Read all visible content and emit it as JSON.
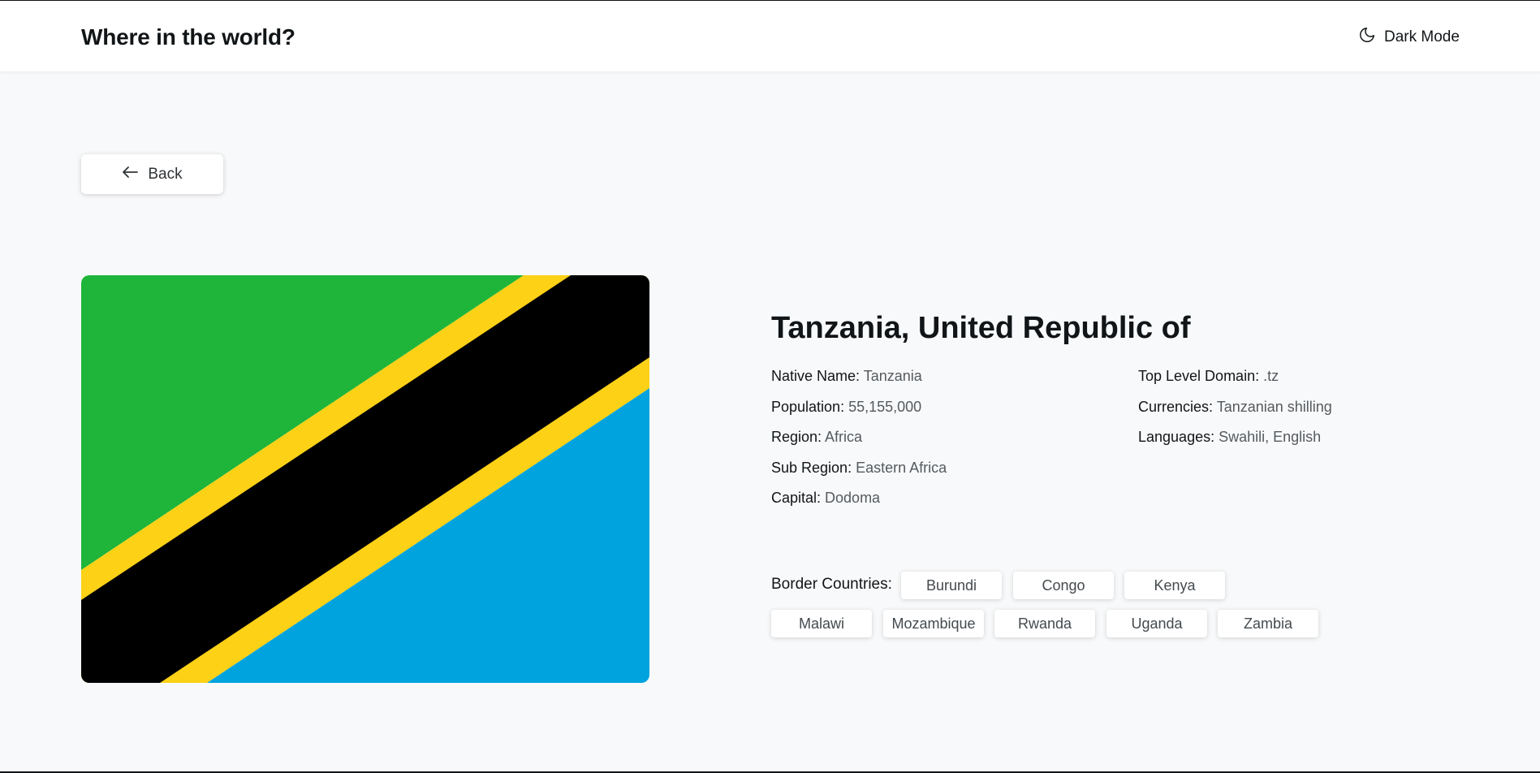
{
  "header": {
    "title": "Where in the world?",
    "theme_toggle_label": "Dark Mode",
    "theme_icon": "moon-icon"
  },
  "back_button": {
    "label": "Back",
    "icon": "arrow-left-icon"
  },
  "country": {
    "name": "Tanzania, United Republic of",
    "flag_colors": {
      "green": "#1eb53a",
      "yellow": "#fcd116",
      "black": "#000000",
      "blue": "#00a3dd"
    },
    "details_left": [
      {
        "label": "Native Name:",
        "value": "Tanzania"
      },
      {
        "label": "Population:",
        "value": "55,155,000"
      },
      {
        "label": "Region:",
        "value": "Africa"
      },
      {
        "label": "Sub Region:",
        "value": "Eastern Africa"
      },
      {
        "label": "Capital:",
        "value": "Dodoma"
      }
    ],
    "details_right": [
      {
        "label": "Top Level Domain:",
        "value": ".tz"
      },
      {
        "label": "Currencies:",
        "value": "Tanzanian shilling"
      },
      {
        "label": "Languages:",
        "value": "Swahili, English"
      }
    ],
    "border_countries_label": "Border Countries:",
    "border_countries": [
      "Burundi",
      "Congo",
      "Kenya",
      "Malawi",
      "Mozambique",
      "Rwanda",
      "Uganda",
      "Zambia"
    ]
  }
}
